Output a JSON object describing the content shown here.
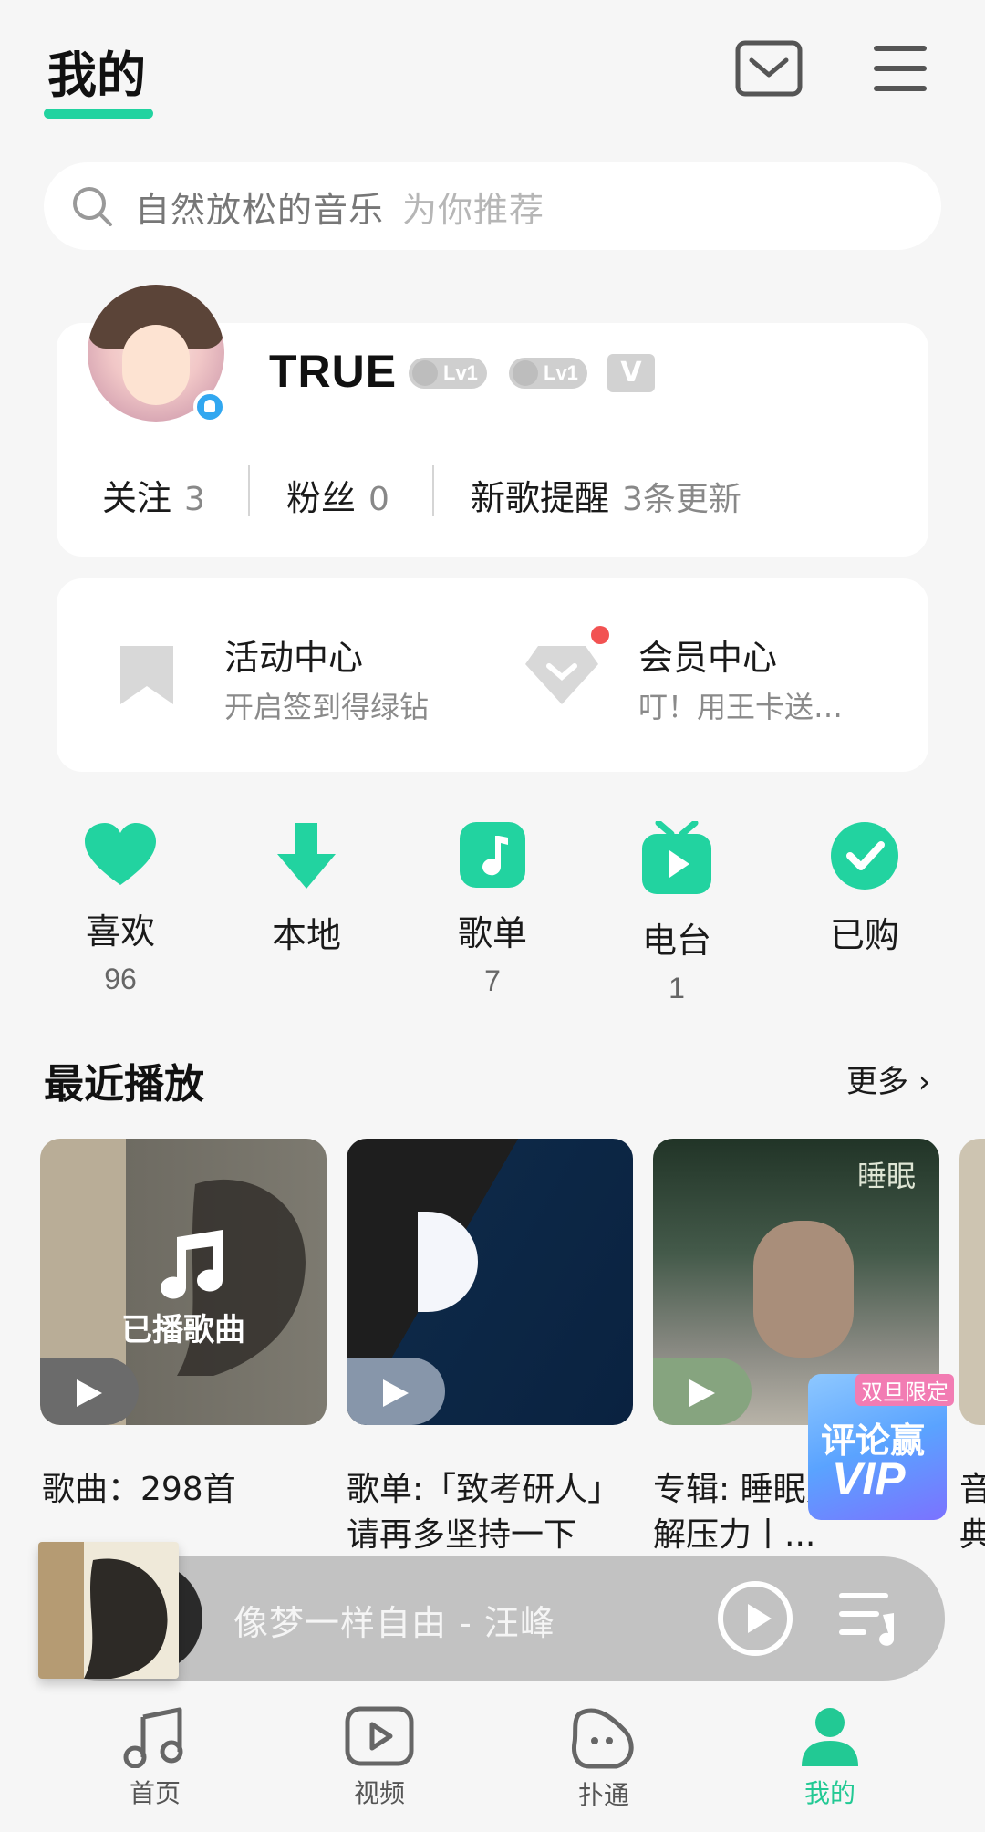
{
  "header": {
    "title": "我的"
  },
  "search": {
    "text": "自然放松的音乐",
    "hint": "为你推荐"
  },
  "profile": {
    "username": "TRUE",
    "badges": [
      "Lv1",
      "Lv1"
    ],
    "follow_label": "关注",
    "follow_count": "3",
    "fans_label": "粉丝",
    "fans_count": "0",
    "newsong_label": "新歌提醒",
    "newsong_count": "3条更新"
  },
  "activity": {
    "event_title": "活动中心",
    "event_sub": "开启签到得绿钻",
    "member_title": "会员中心",
    "member_sub": "叮！用王卡送…"
  },
  "quick": [
    {
      "label": "喜欢",
      "count": "96",
      "icon": "heart-icon"
    },
    {
      "label": "本地",
      "count": "",
      "icon": "download-icon"
    },
    {
      "label": "歌单",
      "count": "7",
      "icon": "playlist-icon"
    },
    {
      "label": "电台",
      "count": "1",
      "icon": "radio-icon"
    },
    {
      "label": "已购",
      "count": "",
      "icon": "purchased-icon"
    }
  ],
  "recent": {
    "title": "最近播放",
    "more": "更多",
    "tiles": [
      {
        "overlay": "已播歌曲",
        "caption": "歌曲：298首"
      },
      {
        "overlay": "",
        "caption": "歌单:「致考研人」请再多坚持一下"
      },
      {
        "overlay": "睡眠",
        "caption": "专辑: 睡眠身心丨缓解压力丨..."
      },
      {
        "overlay": "",
        "caption": "音典"
      }
    ],
    "promo": {
      "tag": "双旦限定",
      "line1": "评论赢",
      "line2": "VIP"
    }
  },
  "player": {
    "title": "像梦一样自由 - 汪峰"
  },
  "nav": [
    {
      "label": "首页",
      "icon": "music-note-icon"
    },
    {
      "label": "视频",
      "icon": "video-icon"
    },
    {
      "label": "扑通",
      "icon": "putong-icon"
    },
    {
      "label": "我的",
      "icon": "profile-icon"
    }
  ],
  "colors": {
    "accent": "#22d3a0",
    "red_dot": "#f25252"
  }
}
